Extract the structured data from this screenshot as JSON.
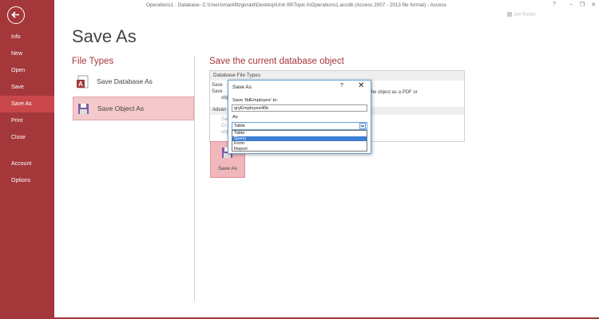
{
  "titlebar": {
    "title": "Operations1 : Database- C:\\Users\\markfitzgerald\\Desktop\\Unit 09\\Topic A\\Operations1.accdb (Access 2007 - 2013 file format) - Access",
    "help": "?",
    "minimize": "–",
    "restore": "❐",
    "close": "✕",
    "user_name": "Joel Rhodes"
  },
  "sidebar": {
    "back_icon": "back-arrow-icon",
    "items": [
      {
        "label": "Info"
      },
      {
        "label": "New"
      },
      {
        "label": "Open"
      },
      {
        "label": "Save"
      },
      {
        "label": "Save As",
        "selected": true
      },
      {
        "label": "Print"
      },
      {
        "label": "Close"
      },
      {
        "label": "Account"
      },
      {
        "label": "Options"
      }
    ]
  },
  "page": {
    "title": "Save As",
    "file_types_heading": "File Types",
    "file_types": [
      {
        "label": "Save Database As",
        "icon": "database-save-icon"
      },
      {
        "label": "Save Object As",
        "icon": "object-save-icon",
        "selected": true
      }
    ],
    "save_current_heading": "Save the current database object",
    "panel": {
      "header": "Database File Types",
      "fragment_save": "Save",
      "fragment_save2": "Save",
      "fragment_obj": "obj",
      "fragment_pdf": "the object as a PDF or",
      "fragment_adv": "Advan",
      "fragment_c": "Sav",
      "fragment_c2": "Cr",
      "fragment_c3": "obj"
    },
    "save_as_button": "Save As"
  },
  "dialog": {
    "title": "Save As",
    "help": "?",
    "close": "✕",
    "name_label": "Save 'tblEmployee' to:",
    "name_value": "qryEmployee40k",
    "as_label": "As",
    "as_value": "Table",
    "options": [
      "Table",
      "Query",
      "Form",
      "Report"
    ],
    "highlighted_option": "Query"
  },
  "colors": {
    "accent": "#a4373a",
    "selected_tile": "#f3c9cb",
    "highlight": "#3b7ed3"
  }
}
